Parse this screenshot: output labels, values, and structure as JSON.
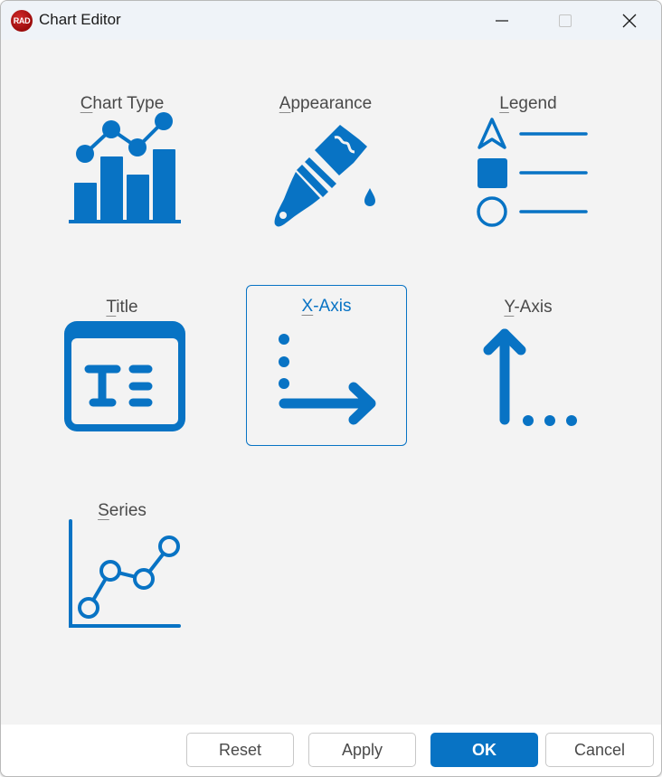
{
  "window": {
    "title": "Chart Editor",
    "app_logo_text": "RAD",
    "controls": {
      "minimize": "minimize-icon",
      "maximize": "maximize-icon",
      "close": "close-icon"
    }
  },
  "tiles": [
    {
      "id": "chart-type",
      "mnemonic": "C",
      "rest": "hart Type",
      "label": "Chart Type",
      "icon": "bar-line-chart-icon",
      "selected": false
    },
    {
      "id": "appearance",
      "mnemonic": "A",
      "rest": "ppearance",
      "label": "Appearance",
      "icon": "paint-brush-icon",
      "selected": false
    },
    {
      "id": "legend",
      "mnemonic": "L",
      "rest": "egend",
      "label": "Legend",
      "icon": "legend-icon",
      "selected": false
    },
    {
      "id": "title",
      "mnemonic": "T",
      "rest": "itle",
      "label": "Title",
      "icon": "title-text-icon",
      "selected": false
    },
    {
      "id": "x-axis",
      "mnemonic": "X",
      "rest": "-Axis",
      "label": "X-Axis",
      "icon": "x-axis-arrow-icon",
      "selected": true
    },
    {
      "id": "y-axis",
      "mnemonic": "Y",
      "rest": "-Axis",
      "label": "Y-Axis",
      "icon": "y-axis-arrow-icon",
      "selected": false
    },
    {
      "id": "series",
      "mnemonic": "S",
      "rest": "eries",
      "label": "Series",
      "icon": "line-series-icon",
      "selected": false
    }
  ],
  "footer": {
    "reset_label": "Reset",
    "apply_label": "Apply",
    "ok_label": "OK",
    "cancel_label": "Cancel"
  },
  "colors": {
    "accent": "#0873C4",
    "titlebar": "#EFF3F8",
    "body": "#F3F3F3",
    "logo": "#B01818"
  }
}
